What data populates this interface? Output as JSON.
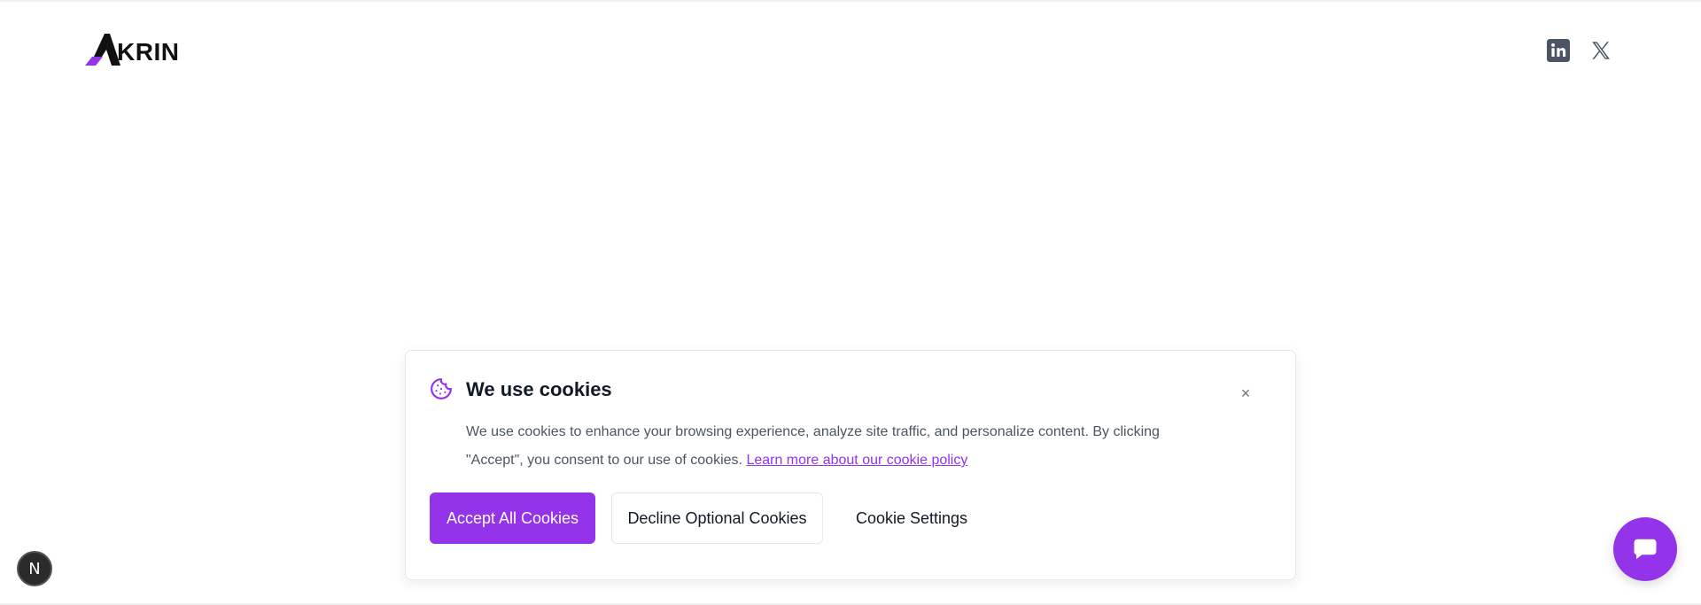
{
  "header": {
    "logo_text": "KRIN",
    "logo_icon": "krin-logo-mark",
    "social": [
      {
        "name": "LinkedIn",
        "icon": "linkedin-icon"
      },
      {
        "name": "X",
        "icon": "x-icon"
      }
    ]
  },
  "cookie_banner": {
    "title": "We use cookies",
    "body": "We use cookies to enhance your browsing experience, analyze site traffic, and personalize content. By clicking \"Accept\", you consent to our use of cookies.",
    "link_text": "Learn more about our cookie policy",
    "close_label": "×",
    "buttons": {
      "accept": "Accept All Cookies",
      "decline": "Decline Optional Cookies",
      "settings": "Cookie Settings"
    }
  },
  "overlay": {
    "next_badge": "N"
  },
  "colors": {
    "accent": "#9333ea",
    "text": "#111827",
    "muted": "#4b5563",
    "border": "#e5e7eb"
  }
}
